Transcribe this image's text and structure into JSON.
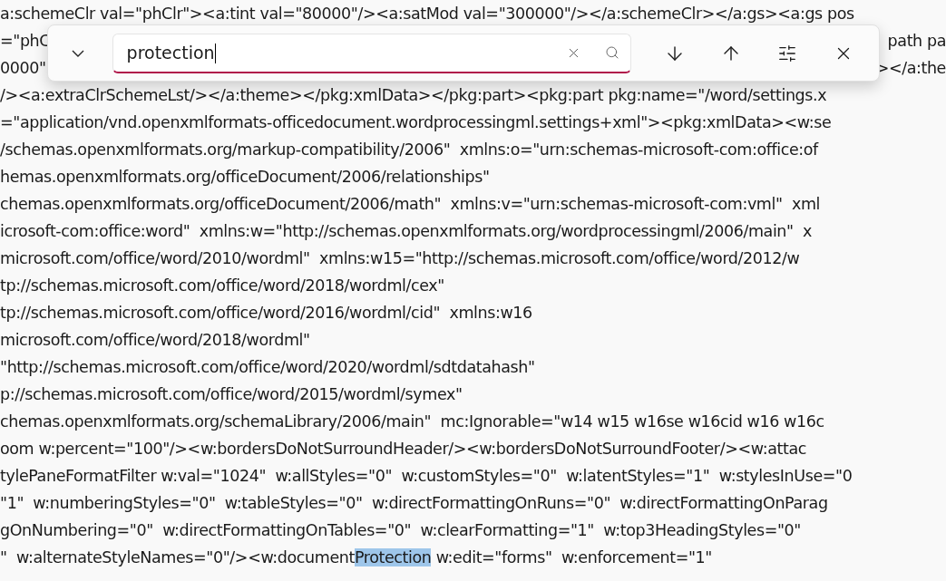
{
  "editor": {
    "lines": [
      {
        "segments": [
          {
            "text": "a:schemeClr val=\"phClr\"><a:tint val=\"80000\"/><a:satMod val=\"300000\"/></a:schemeClr></a:gs><a:gs pos",
            "highlighted": false
          }
        ]
      },
      {
        "segments": [
          {
            "text": "=\"phC",
            "highlighted": false
          }
        ],
        "trailing": "path pa"
      },
      {
        "segments": [
          {
            "text": "0000\"",
            "highlighted": false
          }
        ],
        "trailing": "></a:the"
      },
      {
        "segments": [
          {
            "text": "/><a:extraClrSchemeLst/></a:theme></pkg:xmlData></pkg:part><pkg:part pkg:name=\"/word/settings.x",
            "highlighted": false
          }
        ]
      },
      {
        "segments": [
          {
            "text": "=\"application/vnd.openxmlformats-officedocument.wordprocessingml.settings+xml\"><pkg:xmlData><w:se",
            "highlighted": false
          }
        ]
      },
      {
        "segments": [
          {
            "text": "/schemas.openxmlformats.org/markup-compatibility/2006\"  xmlns:o=\"urn:schemas-microsoft-com:office:of",
            "highlighted": false
          }
        ]
      },
      {
        "segments": [
          {
            "text": "hemas.openxmlformats.org/officeDocument/2006/relationships\"",
            "highlighted": false
          }
        ]
      },
      {
        "segments": [
          {
            "text": "chemas.openxmlformats.org/officeDocument/2006/math\"  xmlns:v=\"urn:schemas-microsoft-com:vml\"  xml",
            "highlighted": false
          }
        ]
      },
      {
        "segments": [
          {
            "text": "icrosoft-com:office:word\"  xmlns:w=\"http://schemas.openxmlformats.org/wordprocessingml/2006/main\"  x",
            "highlighted": false
          }
        ]
      },
      {
        "segments": [
          {
            "text": "microsoft.com/office/word/2010/wordml\"  xmlns:w15=\"http://schemas.microsoft.com/office/word/2012/w",
            "highlighted": false
          }
        ]
      },
      {
        "segments": [
          {
            "text": "tp://schemas.microsoft.com/office/word/2018/wordml/cex\"",
            "highlighted": false
          }
        ]
      },
      {
        "segments": [
          {
            "text": "tp://schemas.microsoft.com/office/word/2016/wordml/cid\"  xmlns:w16",
            "highlighted": false
          }
        ]
      },
      {
        "segments": [
          {
            "text": "microsoft.com/office/word/2018/wordml\"",
            "highlighted": false
          }
        ]
      },
      {
        "segments": [
          {
            "text": "\"http://schemas.microsoft.com/office/word/2020/wordml/sdtdatahash\"",
            "highlighted": false
          }
        ]
      },
      {
        "segments": [
          {
            "text": "p://schemas.microsoft.com/office/word/2015/wordml/symex\"",
            "highlighted": false
          }
        ]
      },
      {
        "segments": [
          {
            "text": "chemas.openxmlformats.org/schemaLibrary/2006/main\"  mc:Ignorable=\"w14 w15 w16se w16cid w16 w16c",
            "highlighted": false
          }
        ]
      },
      {
        "segments": [
          {
            "text": "oom w:percent=\"100\"/><w:bordersDoNotSurroundHeader/><w:bordersDoNotSurroundFooter/><w:attac",
            "highlighted": false
          }
        ]
      },
      {
        "segments": [
          {
            "text": "tylePaneFormatFilter w:val=\"1024\"  w:allStyles=\"0\"  w:customStyles=\"0\"  w:latentStyles=\"1\"  w:stylesInUse=\"0",
            "highlighted": false
          }
        ]
      },
      {
        "segments": [
          {
            "text": "\"1\"  w:numberingStyles=\"0\"  w:tableStyles=\"0\"  w:directFormattingOnRuns=\"0\"  w:directFormattingOnParag",
            "highlighted": false
          }
        ]
      },
      {
        "segments": [
          {
            "text": "gOnNumbering=\"0\"  w:directFormattingOnTables=\"0\"  w:clearFormatting=\"1\"  w:top3HeadingStyles=\"0\"",
            "highlighted": false
          }
        ]
      },
      {
        "segments": [
          {
            "text": "\"  w:alternateStyleNames=\"0\"/><w:document",
            "highlighted": false
          },
          {
            "text": "Protection",
            "highlighted": true
          },
          {
            "text": " w:edit=\"forms\"  w:enforcement=\"1\"",
            "highlighted": false
          }
        ]
      }
    ]
  },
  "find_bar": {
    "expanded": false,
    "search": {
      "value": "protection"
    }
  }
}
